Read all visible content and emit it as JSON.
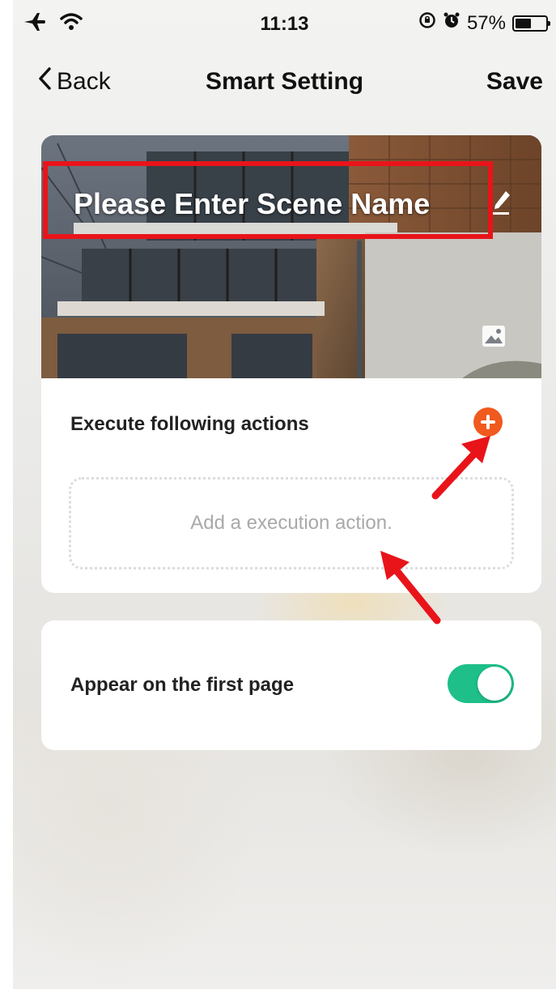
{
  "status_bar": {
    "time": "11:13",
    "battery": "57%",
    "icons": [
      "airplane-icon",
      "wifi-icon",
      "rotation-lock-icon",
      "alarm-icon",
      "battery-icon"
    ],
    "battery_level": 0.57
  },
  "nav": {
    "back_label": "Back",
    "title": "Smart Setting",
    "save_label": "Save"
  },
  "scene": {
    "name_placeholder": "Please Enter Scene Name"
  },
  "actions": {
    "title": "Execute following actions",
    "empty_hint": "Add a execution action."
  },
  "first_page": {
    "label": "Appear on the first page",
    "enabled": true
  },
  "colors": {
    "accent_orange": "#f05a1e",
    "toggle_on": "#1ebf88",
    "annotation_red": "#e8141a"
  }
}
